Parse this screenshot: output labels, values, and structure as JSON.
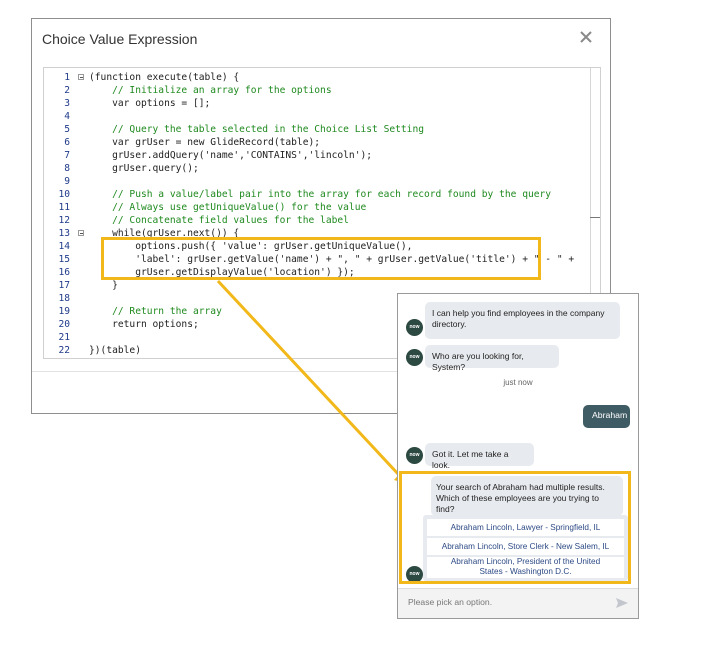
{
  "dialog": {
    "title": "Choice Value Expression",
    "close_icon": "close-x-icon"
  },
  "code": {
    "lines": [
      {
        "n": "1",
        "fold": true
      },
      {
        "n": "2"
      },
      {
        "n": "3"
      },
      {
        "n": "4"
      },
      {
        "n": "5"
      },
      {
        "n": "6"
      },
      {
        "n": "7"
      },
      {
        "n": "8"
      },
      {
        "n": "9"
      },
      {
        "n": "10"
      },
      {
        "n": "11"
      },
      {
        "n": "12"
      },
      {
        "n": "13",
        "fold": true
      },
      {
        "n": "14"
      },
      {
        "n": "15"
      },
      {
        "n": "16"
      },
      {
        "n": "17"
      },
      {
        "n": "18"
      },
      {
        "n": "19"
      },
      {
        "n": "20"
      },
      {
        "n": "21"
      },
      {
        "n": "22"
      }
    ],
    "text": [
      "(function execute(table) {",
      "    // Initialize an array for the options",
      "    var options = [];",
      "",
      "    // Query the table selected in the Choice List Setting",
      "    var grUser = new GlideRecord(table);",
      "    grUser.addQuery('name','CONTAINS','lincoln');",
      "    grUser.query();",
      "",
      "    // Push a value/label pair into the array for each record found by the query",
      "    // Always use getUniqueValue() for the value",
      "    // Concatenate field values for the label",
      "    while(grUser.next()) {",
      "        options.push({ 'value': grUser.getUniqueValue(),",
      "        'label': grUser.getValue('name') + \", \" + grUser.getValue('title') + \" - \" +",
      "        grUser.getDisplayValue('location') });",
      "    }",
      "",
      "    // Return the array",
      "    return options;",
      "",
      "})(table)"
    ]
  },
  "chat": {
    "avatar_label": "now",
    "messages": {
      "bot1": "I can help you find employees in the company directory.",
      "bot2": "Who are you looking for, System?",
      "timestamp": "just now",
      "user1": "Abraham",
      "bot3": "Got it. Let me take a look.",
      "bot4": "Your search of Abraham had multiple results. Which of these employees are you trying to find?"
    },
    "options": [
      "Abraham Lincoln, Lawyer - Springfield, IL",
      "Abraham Lincoln, Store Clerk - New Salem, IL",
      "Abraham Lincoln, President of the United States - Washington D.C."
    ],
    "input_placeholder": "Please pick an option.",
    "send_icon": "send-arrow-icon"
  },
  "colors": {
    "highlight": "#f2b81a",
    "user_bubble": "#3f5b63",
    "bot_bubble": "#e7eaee",
    "avatar": "#2d4a42",
    "option_text": "#2d4a85"
  }
}
